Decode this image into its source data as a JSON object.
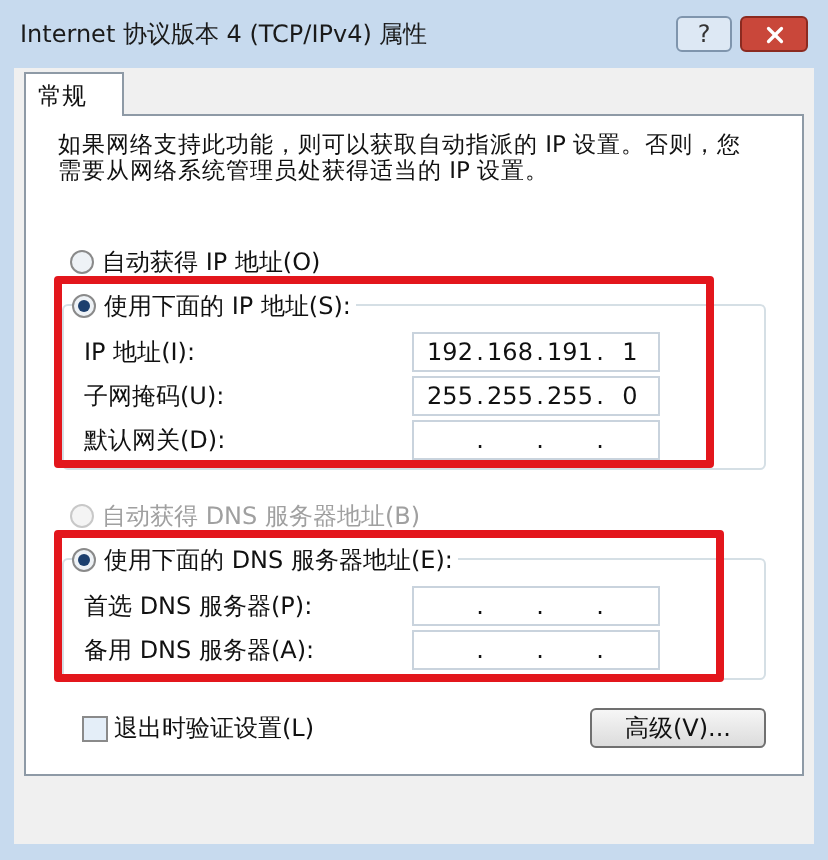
{
  "window": {
    "title": "Internet 协议版本 4 (TCP/IPv4) 属性",
    "help": "?"
  },
  "tabs": [
    {
      "label": "常规",
      "selected": true
    }
  ],
  "description": "如果网络支持此功能，则可以获取自动指派的 IP 设置。否则，您需要从网络系统管理员处获得适当的 IP 设置。",
  "ip_mode": [
    {
      "label": "自动获得 IP 地址(O)",
      "selected": false,
      "disabled": false
    },
    {
      "label": "使用下面的 IP 地址(S):",
      "selected": true,
      "disabled": false,
      "fields": [
        {
          "label": "IP 地址(I):",
          "segments": [
            "192",
            "168",
            "191",
            "1"
          ],
          "separators": [
            ".",
            ".",
            "."
          ]
        },
        {
          "label": "子网掩码(U):",
          "segments": [
            "255",
            "255",
            "255",
            "0"
          ],
          "separators": [
            ".",
            ".",
            "."
          ]
        },
        {
          "label": "默认网关(D):",
          "separators": [
            ".",
            ".",
            "."
          ]
        }
      ]
    }
  ],
  "dns_mode": [
    {
      "label": "自动获得 DNS 服务器地址(B)",
      "selected": false,
      "disabled": true
    },
    {
      "label": "使用下面的 DNS 服务器地址(E):",
      "selected": true,
      "disabled": false,
      "fields": [
        {
          "label": "首选 DNS 服务器(P):",
          "separators": [
            ".",
            ".",
            "."
          ]
        },
        {
          "label": "备用 DNS 服务器(A):",
          "separators": [
            ".",
            ".",
            "."
          ]
        }
      ]
    }
  ],
  "validate": {
    "label": "退出时验证设置(L)",
    "checked": false
  },
  "advanced_button": "高级(V)..."
}
